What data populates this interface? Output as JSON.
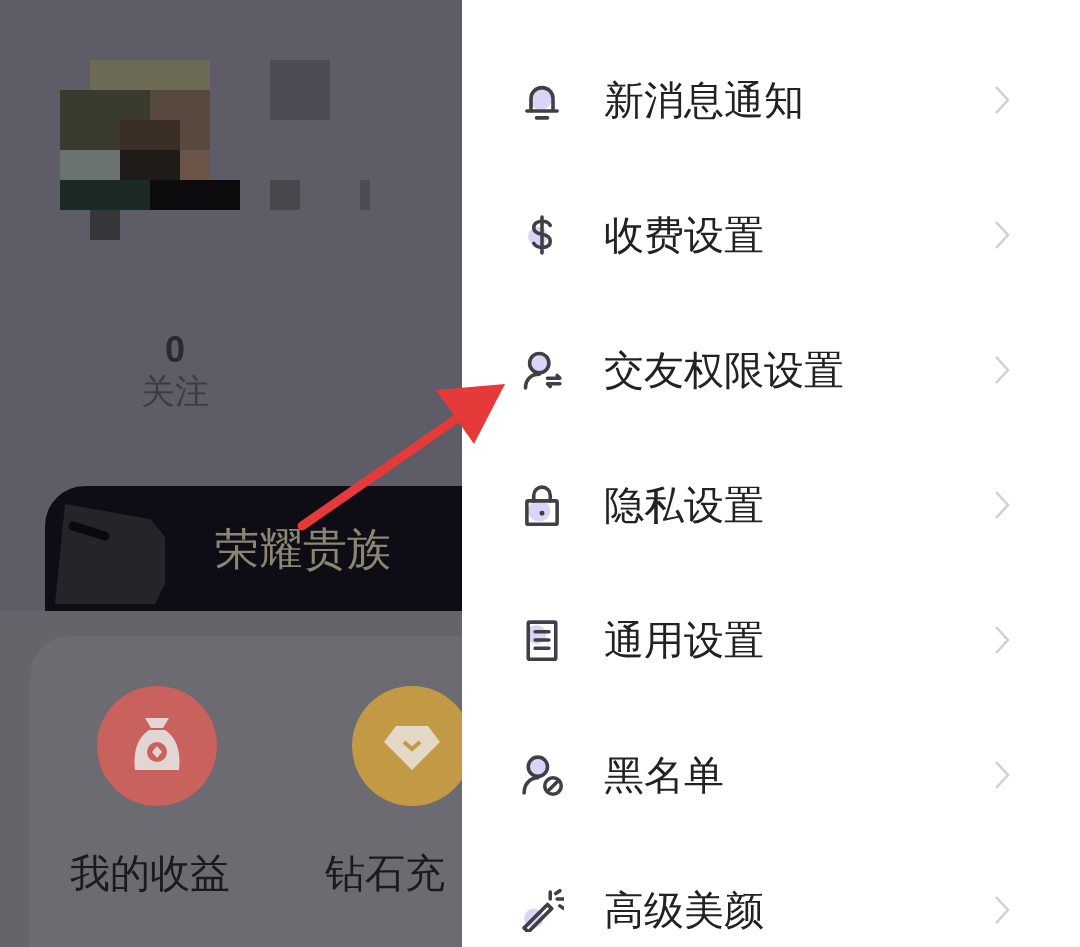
{
  "profile": {
    "stats": [
      {
        "value": "0",
        "label": "关注"
      }
    ]
  },
  "noble_card": {
    "title": "荣耀贵族"
  },
  "shortcuts": [
    {
      "label": "我的收益",
      "color": "#c9615c"
    },
    {
      "label": "钻石充",
      "color": "#c29a46"
    }
  ],
  "drawer": {
    "items": [
      {
        "label": "新消息通知"
      },
      {
        "label": "收费设置"
      },
      {
        "label": "交友权限设置"
      },
      {
        "label": "隐私设置"
      },
      {
        "label": "通用设置"
      },
      {
        "label": "黑名单"
      },
      {
        "label": "高级美颜"
      }
    ]
  }
}
